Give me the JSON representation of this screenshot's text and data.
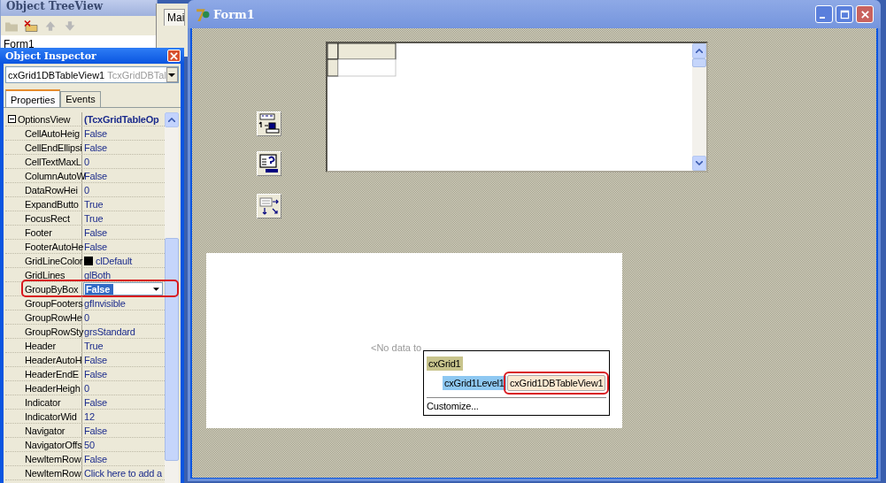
{
  "tree_view": {
    "title": "Object TreeView",
    "items": [
      {
        "label": "Form1"
      }
    ]
  },
  "editor_tab": {
    "label": "Mai"
  },
  "inspector": {
    "title": "Object Inspector",
    "object": {
      "name": "cxGrid1DBTableView1",
      "type": "TcxGridDBTal"
    },
    "tabs": [
      {
        "label": "Properties",
        "selected": true
      },
      {
        "label": "Events",
        "selected": false
      }
    ],
    "properties": [
      {
        "name": "OptionsView",
        "value": "(TcxGridTableOp",
        "expanded": true,
        "children": [
          {
            "name": "CellAutoHeig",
            "value": "False",
            "editing": false,
            "callout": false
          },
          {
            "name": "CellEndEllipsi",
            "value": "False",
            "editing": false,
            "callout": false
          },
          {
            "name": "CellTextMaxL",
            "value": "0",
            "editing": false,
            "callout": false
          },
          {
            "name": "ColumnAutoW",
            "value": "False",
            "editing": false,
            "callout": false
          },
          {
            "name": "DataRowHei",
            "value": "0",
            "editing": false,
            "callout": false
          },
          {
            "name": "ExpandButto",
            "value": "True",
            "editing": false,
            "callout": false
          },
          {
            "name": "FocusRect",
            "value": "True",
            "editing": false,
            "callout": false
          },
          {
            "name": "Footer",
            "value": "False",
            "editing": false,
            "callout": false
          },
          {
            "name": "FooterAutoHe",
            "value": "False",
            "editing": false,
            "callout": false
          },
          {
            "name": "GridLineColor",
            "value": "clDefault",
            "color": "#000000",
            "editing": false,
            "callout": false
          },
          {
            "name": "GridLines",
            "value": "glBoth",
            "editing": false,
            "callout": false
          },
          {
            "name": "GroupByBox",
            "value": "False",
            "editing": true,
            "callout": true
          },
          {
            "name": "GroupFooters",
            "value": "gfInvisible",
            "editing": false,
            "callout": false
          },
          {
            "name": "GroupRowHe",
            "value": "0",
            "editing": false,
            "callout": false
          },
          {
            "name": "GroupRowSty",
            "value": "grsStandard",
            "editing": false,
            "callout": false
          },
          {
            "name": "Header",
            "value": "True",
            "editing": false,
            "callout": false
          },
          {
            "name": "HeaderAutoH",
            "value": "False",
            "editing": false,
            "callout": false
          },
          {
            "name": "HeaderEndE",
            "value": "False",
            "editing": false,
            "callout": false
          },
          {
            "name": "HeaderHeigh",
            "value": "0",
            "editing": false,
            "callout": false
          },
          {
            "name": "Indicator",
            "value": "False",
            "editing": false,
            "callout": false
          },
          {
            "name": "IndicatorWid",
            "value": "12",
            "editing": false,
            "callout": false
          },
          {
            "name": "Navigator",
            "value": "False",
            "editing": false,
            "callout": false
          },
          {
            "name": "NavigatorOffs",
            "value": "50",
            "editing": false,
            "callout": false
          },
          {
            "name": "NewItemRow",
            "value": "False",
            "editing": false,
            "callout": false
          },
          {
            "name": "NewItemRow",
            "value": "Click here to add a",
            "editing": false,
            "callout": false
          }
        ]
      }
    ]
  },
  "form": {
    "title": "Form1",
    "grid": {
      "empty_text": "<No data to"
    },
    "popup": {
      "items": [
        {
          "label": "cxGrid1",
          "kind": "grid",
          "callout": false
        },
        {
          "label": "cxGrid1Level1",
          "kind": "level",
          "callout": false
        },
        {
          "label": "cxGrid1DBTableView1",
          "kind": "view",
          "callout": true
        }
      ],
      "customize": "Customize..."
    }
  }
}
